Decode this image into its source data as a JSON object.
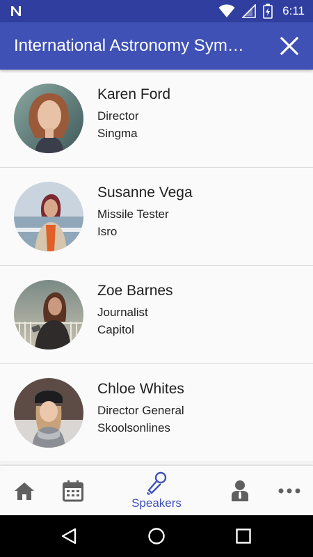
{
  "status_bar": {
    "time": "6:11",
    "icons": [
      "n-logo-icon",
      "wifi-icon",
      "signal-icon",
      "battery-charging-icon"
    ]
  },
  "app_bar": {
    "title": "International Astronomy Sym…",
    "close_icon": "close-icon"
  },
  "speakers": [
    {
      "name": "Karen Ford",
      "role": "Director",
      "organization": "Singma"
    },
    {
      "name": "Susanne Vega",
      "role": "Missile Tester",
      "organization": "Isro"
    },
    {
      "name": "Zoe Barnes",
      "role": "Journalist",
      "organization": "Capitol"
    },
    {
      "name": "Chloe Whites",
      "role": "Director General",
      "organization": "Skoolsonlines"
    }
  ],
  "bottom_nav": {
    "items": [
      {
        "icon": "home-icon",
        "label": ""
      },
      {
        "icon": "calendar-icon",
        "label": ""
      },
      {
        "icon": "microphone-icon",
        "label": "Speakers",
        "active": true
      },
      {
        "icon": "person-icon",
        "label": ""
      },
      {
        "icon": "more-icon",
        "label": ""
      }
    ],
    "active_color": "#3f51b5",
    "inactive_color": "#5f5f5f"
  },
  "system_nav": {
    "buttons": [
      "back-icon",
      "home-circle-icon",
      "recents-icon"
    ]
  },
  "colors": {
    "primary": "#3f51b5",
    "primary_dark": "#303f9f",
    "background": "#fafafa",
    "divider": "#dcdcdc"
  }
}
